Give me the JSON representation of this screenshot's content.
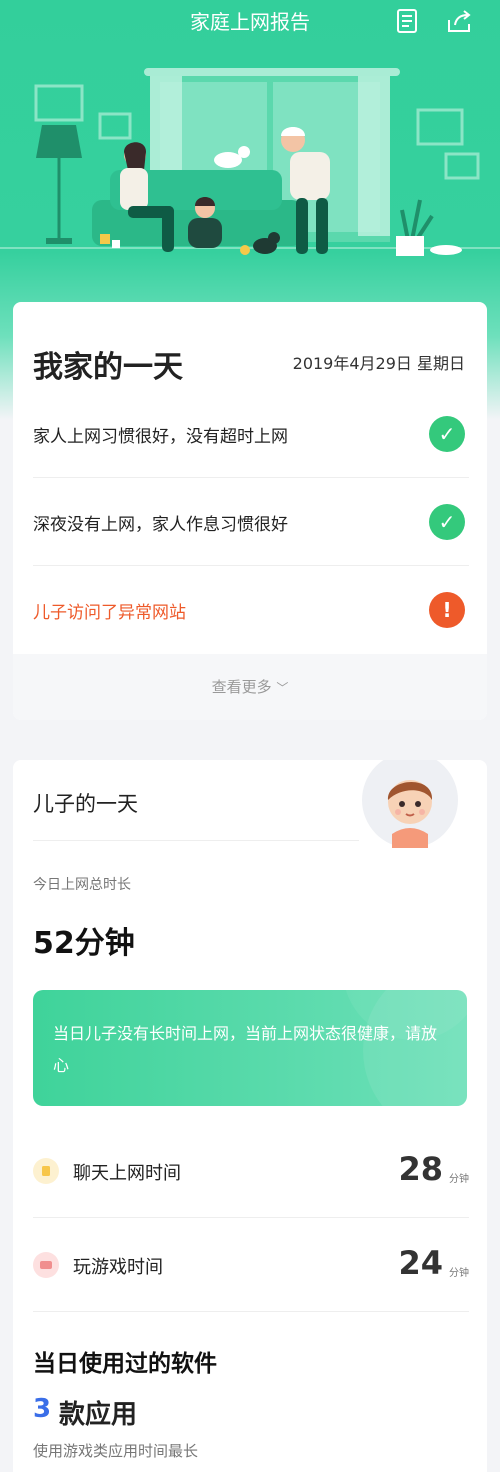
{
  "header": {
    "title": "家庭上网报告",
    "report_icon": "document-icon",
    "share_icon": "share-icon"
  },
  "summary_card": {
    "title": "我家的一天",
    "date": "2019年4月29日  星期日",
    "items": [
      {
        "text": "家人上网习惯很好，没有超时上网",
        "status": "ok"
      },
      {
        "text": "深夜没有上网，家人作息习惯很好",
        "status": "ok"
      },
      {
        "text": "儿子访问了异常网站",
        "status": "warning"
      }
    ],
    "more_label": "查看更多"
  },
  "member_card": {
    "title": "儿子的一天",
    "total_label": "今日上网总时长",
    "total_value": "52分钟",
    "banner_text": "当日儿子没有长时间上网，当前上网状态很健康，请放心",
    "stats": [
      {
        "label": "聊天上网时间",
        "value": "28",
        "unit": "分钟",
        "icon": "chat-icon",
        "color": "#f7c64a"
      },
      {
        "label": "玩游戏时间",
        "value": "24",
        "unit": "分钟",
        "icon": "game-icon",
        "color": "#f08f8f"
      }
    ],
    "apps_title": "当日使用过的软件",
    "apps_count": "3",
    "apps_count_label": "款应用",
    "apps_note": "使用游戏类应用时间最长"
  },
  "colors": {
    "brand": "#33cf9b",
    "ok": "#34c97c",
    "warning": "#ee5a2a",
    "accent_blue": "#3a6ee8"
  }
}
